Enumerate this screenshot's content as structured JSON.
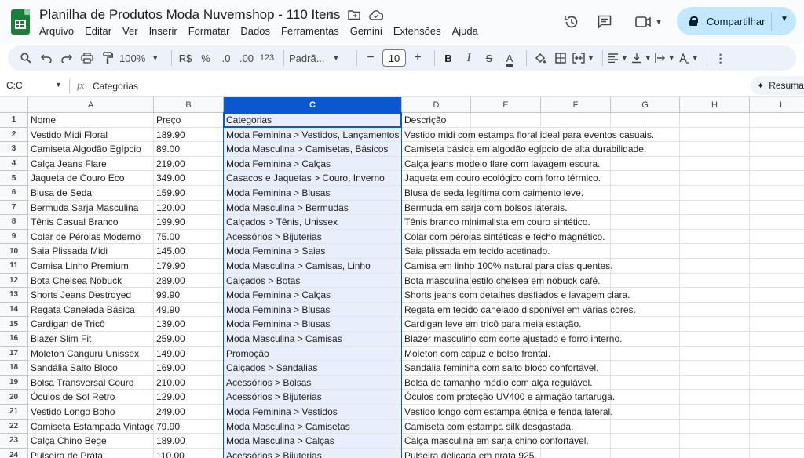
{
  "app": {
    "title": "Planilha de Produtos Moda Nuvemshop - 110 Itens",
    "menu": [
      "Arquivo",
      "Editar",
      "Ver",
      "Inserir",
      "Formatar",
      "Dados",
      "Ferramentas",
      "Gemini",
      "Extensões",
      "Ajuda"
    ],
    "share_label": "Compartilhar"
  },
  "toolbar": {
    "zoom": "100%",
    "currency": "R$",
    "percent": "%",
    "dec_less": ".0",
    "dec_more": ".00",
    "number_format": "123",
    "font": "Padrã...",
    "font_size": "10",
    "bold": "B",
    "italic": "I",
    "strike": "S",
    "text_color": "A"
  },
  "formula_bar": {
    "name_box": "C:C",
    "fx": "fx",
    "content": "Categorias",
    "summary_label": "Resuma"
  },
  "sheet": {
    "columns": [
      "A",
      "B",
      "C",
      "D",
      "E",
      "F",
      "G",
      "H",
      "I"
    ],
    "selected_column": "C",
    "rows": [
      [
        "Nome",
        "Preço",
        "Categorias",
        "Descrição"
      ],
      [
        "Vestido Midi Floral",
        "189.90",
        "Moda Feminina > Vestidos, Lançamentos",
        "Vestido midi com estampa floral ideal para eventos casuais."
      ],
      [
        "Camiseta Algodão Egípcio",
        "89.00",
        "Moda Masculina > Camisetas, Básicos",
        "Camiseta básica em algodão egípcio de alta durabilidade."
      ],
      [
        "Calça Jeans Flare",
        "219.00",
        "Moda Feminina > Calças",
        "Calça jeans modelo flare com lavagem escura."
      ],
      [
        "Jaqueta de Couro Eco",
        "349.00",
        "Casacos e Jaquetas > Couro, Inverno",
        "Jaqueta em couro ecológico com forro térmico."
      ],
      [
        "Blusa de Seda",
        "159.90",
        "Moda Feminina > Blusas",
        "Blusa de seda legítima com caimento leve."
      ],
      [
        "Bermuda Sarja Masculina",
        "120.00",
        "Moda Masculina > Bermudas",
        "Bermuda em sarja com bolsos laterais."
      ],
      [
        "Tênis Casual Branco",
        "199.90",
        "Calçados > Tênis, Unissex",
        "Tênis branco minimalista em couro sintético."
      ],
      [
        "Colar de Pérolas Moderno",
        "75.00",
        "Acessórios > Bijuterias",
        "Colar com pérolas sintéticas e fecho magnético."
      ],
      [
        "Saia Plissada Midi",
        "145.00",
        "Moda Feminina > Saias",
        "Saia plissada em tecido acetinado."
      ],
      [
        "Camisa Linho Premium",
        "179.90",
        "Moda Masculina > Camisas, Linho",
        "Camisa em linho 100% natural para dias quentes."
      ],
      [
        "Bota Chelsea Nobuck",
        "289.00",
        "Calçados > Botas",
        "Bota masculina estilo chelsea em nobuck café."
      ],
      [
        "Shorts Jeans Destroyed",
        "99.90",
        "Moda Feminina > Calças",
        "Shorts jeans com detalhes desfiados e lavagem clara."
      ],
      [
        "Regata Canelada Básica",
        "49.90",
        "Moda Feminina > Blusas",
        "Regata em tecido canelado disponível em várias cores."
      ],
      [
        "Cardigan de Tricô",
        "139.00",
        "Moda Feminina > Blusas",
        "Cardigan leve em tricô para meia estação."
      ],
      [
        "Blazer Slim Fit",
        "259.00",
        "Moda Masculina > Camisas",
        "Blazer masculino com corte ajustado e forro interno."
      ],
      [
        "Moleton Canguru Unissex",
        "149.00",
        "Promoção",
        "Moleton com capuz e bolso frontal."
      ],
      [
        "Sandália Salto Bloco",
        "169.00",
        "Calçados > Sandálias",
        "Sandália feminina com salto bloco confortável."
      ],
      [
        "Bolsa Transversal Couro",
        "210.00",
        "Acessórios > Bolsas",
        "Bolsa de tamanho médio com alça regulável."
      ],
      [
        "Óculos de Sol Retro",
        "129.00",
        "Acessórios > Bijuterias",
        "Óculos com proteção UV400 e armação tartaruga."
      ],
      [
        "Vestido Longo Boho",
        "249.00",
        "Moda Feminina > Vestidos",
        "Vestido longo com estampa étnica e fenda lateral."
      ],
      [
        "Camiseta Estampada Vintage",
        "79.90",
        "Moda Masculina > Camisetas",
        "Camiseta com estampa silk desgastada."
      ],
      [
        "Calça Chino Bege",
        "189.00",
        "Moda Masculina > Calças",
        "Calça masculina em sarja chino confortável."
      ],
      [
        "Pulseira de Prata",
        "110.00",
        "Acessórios > Bijuterias",
        "Pulseira delicada em prata 925."
      ]
    ]
  }
}
